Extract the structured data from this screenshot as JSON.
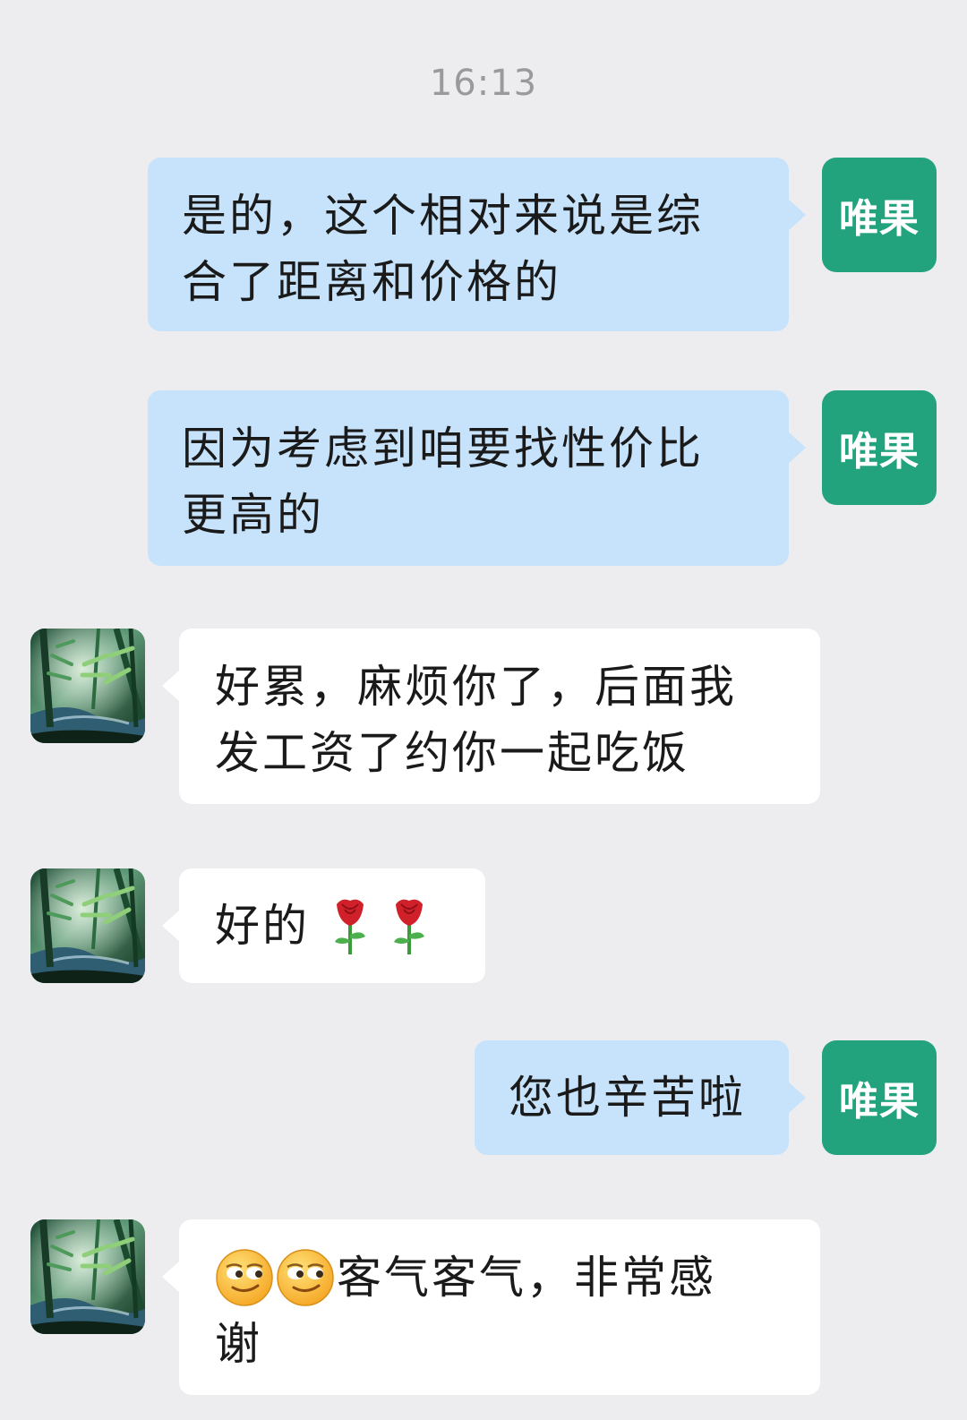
{
  "timestamp": "16:13",
  "me": {
    "avatar_label": "唯果",
    "avatar_color": "#22a37e",
    "bubble_color": "#c7e3fb"
  },
  "other": {
    "avatar_icon": "bamboo-forest-avatar",
    "bubble_color": "#ffffff"
  },
  "messages": [
    {
      "sender": "me",
      "lines": [
        "是的，这个相对来说是综",
        "合了距离和价格的"
      ]
    },
    {
      "sender": "me",
      "lines": [
        "因为考虑到咱要找性价比",
        "更高的"
      ]
    },
    {
      "sender": "other",
      "lines": [
        "好累，麻烦你了，后面我",
        "发工资了约你一起吃饭"
      ]
    },
    {
      "sender": "other",
      "text": "好的",
      "emoji": [
        "rose-icon",
        "rose-icon"
      ]
    },
    {
      "sender": "me",
      "text": "您也辛苦啦"
    },
    {
      "sender": "other",
      "emoji": [
        "smirk-face-icon",
        "smirk-face-icon"
      ],
      "lines": [
        "客气客气，非常感",
        "谢"
      ]
    }
  ]
}
